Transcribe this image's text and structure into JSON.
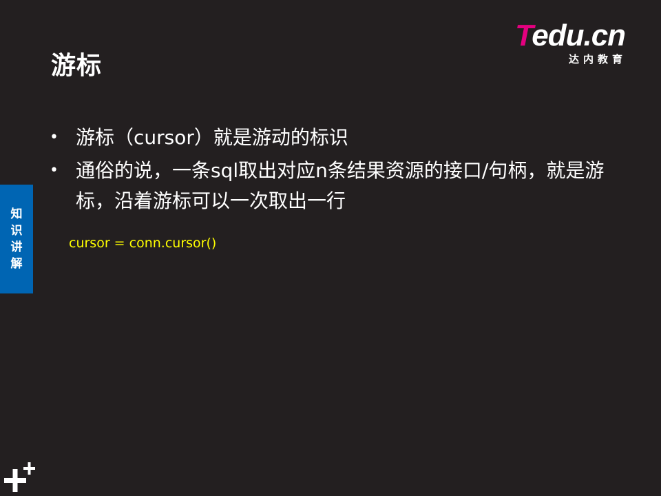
{
  "slide": {
    "title": "游标",
    "logo": {
      "brand_t": "T",
      "brand_rest": "edu.cn",
      "subtitle": "达内教育"
    },
    "sidebar_tab": [
      "知",
      "识",
      "讲",
      "解"
    ],
    "bullets": [
      "游标（cursor）就是游动的标识",
      "通俗的说，一条sql取出对应n条结果资源的接口/句柄，就是游标，沿着游标可以一次取出一行"
    ],
    "bullet_glyph": "•",
    "code": "cursor = conn.cursor()",
    "colors": {
      "background": "#231f20",
      "accent_blue": "#0065b3",
      "brand_pink": "#e4007f",
      "code_yellow": "#ffff00"
    },
    "icons": {
      "corner": "plus-plus-icon"
    }
  }
}
